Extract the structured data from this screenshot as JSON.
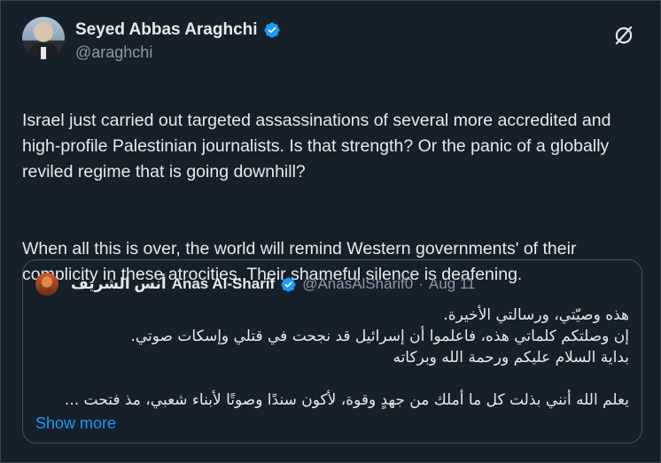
{
  "author": {
    "display_name": "Seyed Abbas Araghchi",
    "handle": "@araghchi",
    "verified_icon": "verified-badge-icon",
    "avatar": "avatar"
  },
  "header": {
    "grok_icon": "grok-icon"
  },
  "tweet": {
    "paragraphs": [
      "Israel just carried out targeted assassinations of several more accredited and high-profile Palestinian journalists. Is that strength? Or the panic of a globally reviled regime that is going downhill?",
      "When all this is over, the world will remind Western governments' of their complicity in these atrocities. Their shameful silence is deafening."
    ]
  },
  "quote": {
    "arabic_name": "أنس الشريف",
    "name": "Anas Al-Sharif",
    "handle": "@AnasAlSharif0",
    "separator": "·",
    "date": "Aug 11",
    "lines": [
      "هذه وصيّتي، ورسالتي الأخيرة.",
      "إن وصلتكم كلماتي هذه، فاعلموا أن إسرائيل قد نجحت في قتلي وإسكات صوتي.",
      "بداية السلام عليكم ورحمة الله وبركاته",
      "يعلم الله أنني بذلت كل ما أملك من جهدٍ وقوة، لأكون سندًا وصوتًا لأبناء شعبي، مذ فتحت ..."
    ],
    "show_more": "Show more"
  },
  "colors": {
    "background": "#15202b",
    "text": "#e7e9ea",
    "muted": "#8b98a5",
    "accent": "#1d9bf0",
    "border": "#425364"
  }
}
